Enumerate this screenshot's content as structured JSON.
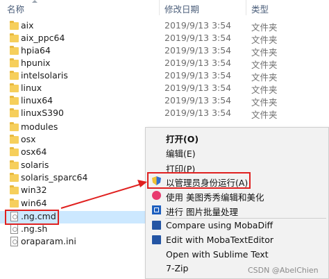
{
  "columns": {
    "name": "名称",
    "date": "修改日期",
    "type": "类型"
  },
  "files": [
    {
      "name": "aix",
      "date": "2019/9/13 3:54",
      "type": "文件夹",
      "icon": "folder-icon"
    },
    {
      "name": "aix_ppc64",
      "date": "2019/9/13 3:54",
      "type": "文件夹",
      "icon": "folder-icon"
    },
    {
      "name": "hpia64",
      "date": "2019/9/13 3:54",
      "type": "文件夹",
      "icon": "folder-icon"
    },
    {
      "name": "hpunix",
      "date": "2019/9/13 3:54",
      "type": "文件夹",
      "icon": "folder-icon"
    },
    {
      "name": "intelsolaris",
      "date": "2019/9/13 3:54",
      "type": "文件夹",
      "icon": "folder-icon"
    },
    {
      "name": "linux",
      "date": "2019/9/13 3:54",
      "type": "文件夹",
      "icon": "folder-icon"
    },
    {
      "name": "linux64",
      "date": "2019/9/13 3:54",
      "type": "文件夹",
      "icon": "folder-icon"
    },
    {
      "name": "linuxS390",
      "date": "2019/9/13 3:54",
      "type": "文件夹",
      "icon": "folder-icon"
    },
    {
      "name": "modules",
      "date": "",
      "type": "",
      "icon": "folder-icon"
    },
    {
      "name": "osx",
      "date": "",
      "type": "",
      "icon": "folder-icon"
    },
    {
      "name": "osx64",
      "date": "",
      "type": "",
      "icon": "folder-icon"
    },
    {
      "name": "solaris",
      "date": "",
      "type": "",
      "icon": "folder-icon"
    },
    {
      "name": "solaris_sparc64",
      "date": "",
      "type": "",
      "icon": "folder-icon"
    },
    {
      "name": "win32",
      "date": "",
      "type": "",
      "icon": "folder-icon"
    },
    {
      "name": "win64",
      "date": "",
      "type": "",
      "icon": "folder-icon"
    },
    {
      "name": ".ng.cmd",
      "date": "",
      "type": "",
      "icon": "cmd-file-icon",
      "selected": true
    },
    {
      "name": ".ng.sh",
      "date": "",
      "type": "",
      "icon": "sh-file-icon"
    },
    {
      "name": "oraparam.ini",
      "date": "",
      "type": "",
      "icon": "ini-file-icon"
    }
  ],
  "context_menu": {
    "items": [
      {
        "label": "打开(O)",
        "bold": true,
        "icon": ""
      },
      {
        "label": "编辑(E)",
        "icon": ""
      },
      {
        "label": "打印(P)",
        "icon": ""
      },
      {
        "label": "以管理员身份运行(A)",
        "icon": "shield-icon"
      },
      {
        "label": "使用 美图秀秀编辑和美化",
        "icon": "meitu-icon"
      },
      {
        "label": "进行 图片批量处理",
        "icon": "batch-image-icon"
      },
      {
        "label": "Compare using MobaDiff",
        "icon": "mobadiff-icon"
      },
      {
        "label": "Edit with MobaTextEditor",
        "icon": "mobatext-icon"
      },
      {
        "label": "Open with Sublime Text",
        "icon": ""
      },
      {
        "label": "7-Zip",
        "icon": ""
      }
    ]
  },
  "watermark": "CSDN @AbelChien",
  "colors": {
    "selection": "#cce8ff",
    "highlight": "#e0201f",
    "menu_bg": "#f2f2f2"
  }
}
